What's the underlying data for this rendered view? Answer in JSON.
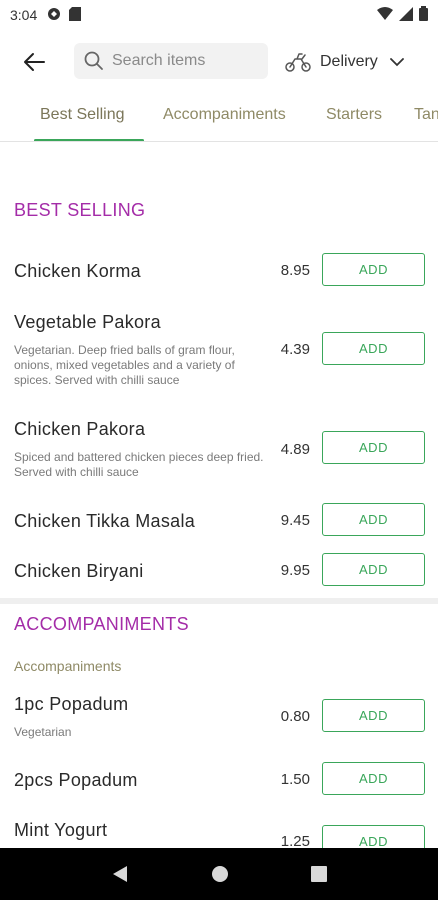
{
  "status": {
    "time": "3:04"
  },
  "header": {
    "search_placeholder": "Search items",
    "delivery_label": "Delivery"
  },
  "tabs": [
    {
      "label": "Best Selling"
    },
    {
      "label": "Accompaniments"
    },
    {
      "label": "Starters"
    },
    {
      "label": "Tan"
    }
  ],
  "sections": {
    "best_selling": {
      "title": "BEST SELLING",
      "items": [
        {
          "name": "Chicken Korma",
          "desc": "",
          "price": "8.95",
          "button": "ADD"
        },
        {
          "name": "Vegetable Pakora",
          "desc": "Vegetarian. Deep fried balls of gram flour, onions, mixed vegetables and a variety of spices. Served with chilli sauce",
          "price": "4.39",
          "button": "ADD"
        },
        {
          "name": "Chicken Pakora",
          "desc": "Spiced and battered chicken pieces deep fried. Served with chilli sauce",
          "price": "4.89",
          "button": "ADD"
        },
        {
          "name": "Chicken Tikka Masala",
          "desc": "",
          "price": "9.45",
          "button": "ADD"
        },
        {
          "name": "Chicken Biryani",
          "desc": "",
          "price": "9.95",
          "button": "ADD"
        }
      ]
    },
    "accompaniments": {
      "title": "ACCOMPANIMENTS",
      "subtitle": "Accompaniments",
      "items": [
        {
          "name": "1pc Popadum",
          "desc": "Vegetarian",
          "price": "0.80",
          "button": "ADD"
        },
        {
          "name": "2pcs Popadum",
          "desc": "",
          "price": "1.50",
          "button": "ADD"
        },
        {
          "name": "Mint Yogurt",
          "desc": "",
          "price": "1.25",
          "button": "ADD"
        }
      ]
    }
  },
  "colors": {
    "accent": "#3aa65a",
    "section": "#a42ca8",
    "tab_text": "#8f8a66"
  }
}
